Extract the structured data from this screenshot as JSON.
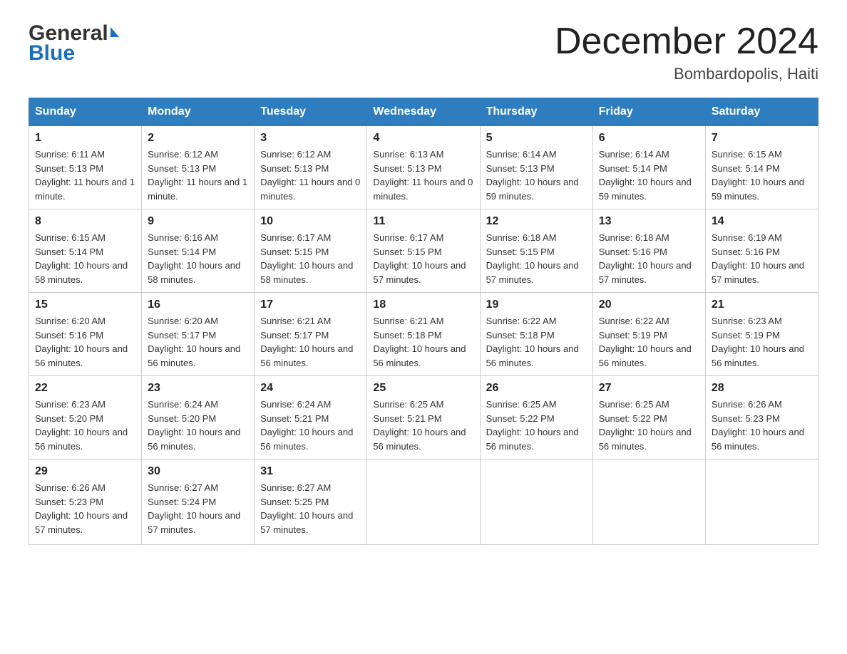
{
  "header": {
    "logo_line1": "General",
    "logo_line2": "Blue",
    "month_title": "December 2024",
    "location": "Bombardopolis, Haiti"
  },
  "days_of_week": [
    "Sunday",
    "Monday",
    "Tuesday",
    "Wednesday",
    "Thursday",
    "Friday",
    "Saturday"
  ],
  "weeks": [
    [
      {
        "day": "1",
        "sunrise": "Sunrise: 6:11 AM",
        "sunset": "Sunset: 5:13 PM",
        "daylight": "Daylight: 11 hours and 1 minute."
      },
      {
        "day": "2",
        "sunrise": "Sunrise: 6:12 AM",
        "sunset": "Sunset: 5:13 PM",
        "daylight": "Daylight: 11 hours and 1 minute."
      },
      {
        "day": "3",
        "sunrise": "Sunrise: 6:12 AM",
        "sunset": "Sunset: 5:13 PM",
        "daylight": "Daylight: 11 hours and 0 minutes."
      },
      {
        "day": "4",
        "sunrise": "Sunrise: 6:13 AM",
        "sunset": "Sunset: 5:13 PM",
        "daylight": "Daylight: 11 hours and 0 minutes."
      },
      {
        "day": "5",
        "sunrise": "Sunrise: 6:14 AM",
        "sunset": "Sunset: 5:13 PM",
        "daylight": "Daylight: 10 hours and 59 minutes."
      },
      {
        "day": "6",
        "sunrise": "Sunrise: 6:14 AM",
        "sunset": "Sunset: 5:14 PM",
        "daylight": "Daylight: 10 hours and 59 minutes."
      },
      {
        "day": "7",
        "sunrise": "Sunrise: 6:15 AM",
        "sunset": "Sunset: 5:14 PM",
        "daylight": "Daylight: 10 hours and 59 minutes."
      }
    ],
    [
      {
        "day": "8",
        "sunrise": "Sunrise: 6:15 AM",
        "sunset": "Sunset: 5:14 PM",
        "daylight": "Daylight: 10 hours and 58 minutes."
      },
      {
        "day": "9",
        "sunrise": "Sunrise: 6:16 AM",
        "sunset": "Sunset: 5:14 PM",
        "daylight": "Daylight: 10 hours and 58 minutes."
      },
      {
        "day": "10",
        "sunrise": "Sunrise: 6:17 AM",
        "sunset": "Sunset: 5:15 PM",
        "daylight": "Daylight: 10 hours and 58 minutes."
      },
      {
        "day": "11",
        "sunrise": "Sunrise: 6:17 AM",
        "sunset": "Sunset: 5:15 PM",
        "daylight": "Daylight: 10 hours and 57 minutes."
      },
      {
        "day": "12",
        "sunrise": "Sunrise: 6:18 AM",
        "sunset": "Sunset: 5:15 PM",
        "daylight": "Daylight: 10 hours and 57 minutes."
      },
      {
        "day": "13",
        "sunrise": "Sunrise: 6:18 AM",
        "sunset": "Sunset: 5:16 PM",
        "daylight": "Daylight: 10 hours and 57 minutes."
      },
      {
        "day": "14",
        "sunrise": "Sunrise: 6:19 AM",
        "sunset": "Sunset: 5:16 PM",
        "daylight": "Daylight: 10 hours and 57 minutes."
      }
    ],
    [
      {
        "day": "15",
        "sunrise": "Sunrise: 6:20 AM",
        "sunset": "Sunset: 5:16 PM",
        "daylight": "Daylight: 10 hours and 56 minutes."
      },
      {
        "day": "16",
        "sunrise": "Sunrise: 6:20 AM",
        "sunset": "Sunset: 5:17 PM",
        "daylight": "Daylight: 10 hours and 56 minutes."
      },
      {
        "day": "17",
        "sunrise": "Sunrise: 6:21 AM",
        "sunset": "Sunset: 5:17 PM",
        "daylight": "Daylight: 10 hours and 56 minutes."
      },
      {
        "day": "18",
        "sunrise": "Sunrise: 6:21 AM",
        "sunset": "Sunset: 5:18 PM",
        "daylight": "Daylight: 10 hours and 56 minutes."
      },
      {
        "day": "19",
        "sunrise": "Sunrise: 6:22 AM",
        "sunset": "Sunset: 5:18 PM",
        "daylight": "Daylight: 10 hours and 56 minutes."
      },
      {
        "day": "20",
        "sunrise": "Sunrise: 6:22 AM",
        "sunset": "Sunset: 5:19 PM",
        "daylight": "Daylight: 10 hours and 56 minutes."
      },
      {
        "day": "21",
        "sunrise": "Sunrise: 6:23 AM",
        "sunset": "Sunset: 5:19 PM",
        "daylight": "Daylight: 10 hours and 56 minutes."
      }
    ],
    [
      {
        "day": "22",
        "sunrise": "Sunrise: 6:23 AM",
        "sunset": "Sunset: 5:20 PM",
        "daylight": "Daylight: 10 hours and 56 minutes."
      },
      {
        "day": "23",
        "sunrise": "Sunrise: 6:24 AM",
        "sunset": "Sunset: 5:20 PM",
        "daylight": "Daylight: 10 hours and 56 minutes."
      },
      {
        "day": "24",
        "sunrise": "Sunrise: 6:24 AM",
        "sunset": "Sunset: 5:21 PM",
        "daylight": "Daylight: 10 hours and 56 minutes."
      },
      {
        "day": "25",
        "sunrise": "Sunrise: 6:25 AM",
        "sunset": "Sunset: 5:21 PM",
        "daylight": "Daylight: 10 hours and 56 minutes."
      },
      {
        "day": "26",
        "sunrise": "Sunrise: 6:25 AM",
        "sunset": "Sunset: 5:22 PM",
        "daylight": "Daylight: 10 hours and 56 minutes."
      },
      {
        "day": "27",
        "sunrise": "Sunrise: 6:25 AM",
        "sunset": "Sunset: 5:22 PM",
        "daylight": "Daylight: 10 hours and 56 minutes."
      },
      {
        "day": "28",
        "sunrise": "Sunrise: 6:26 AM",
        "sunset": "Sunset: 5:23 PM",
        "daylight": "Daylight: 10 hours and 56 minutes."
      }
    ],
    [
      {
        "day": "29",
        "sunrise": "Sunrise: 6:26 AM",
        "sunset": "Sunset: 5:23 PM",
        "daylight": "Daylight: 10 hours and 57 minutes."
      },
      {
        "day": "30",
        "sunrise": "Sunrise: 6:27 AM",
        "sunset": "Sunset: 5:24 PM",
        "daylight": "Daylight: 10 hours and 57 minutes."
      },
      {
        "day": "31",
        "sunrise": "Sunrise: 6:27 AM",
        "sunset": "Sunset: 5:25 PM",
        "daylight": "Daylight: 10 hours and 57 minutes."
      },
      {
        "day": "",
        "sunrise": "",
        "sunset": "",
        "daylight": ""
      },
      {
        "day": "",
        "sunrise": "",
        "sunset": "",
        "daylight": ""
      },
      {
        "day": "",
        "sunrise": "",
        "sunset": "",
        "daylight": ""
      },
      {
        "day": "",
        "sunrise": "",
        "sunset": "",
        "daylight": ""
      }
    ]
  ]
}
